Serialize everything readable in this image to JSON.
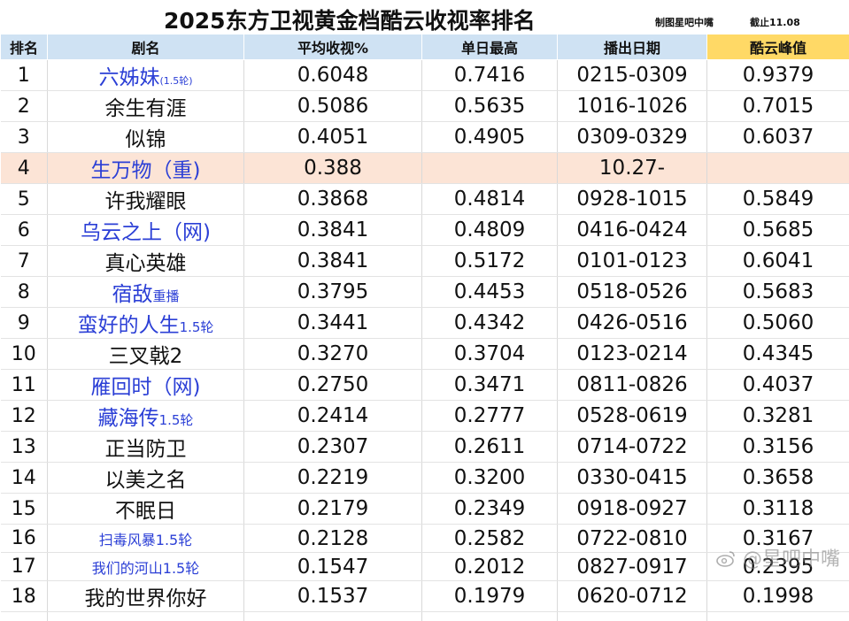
{
  "title": "2025东方卫视黄金档酷云收视率排名",
  "credit_maker": "制图星吧中嘴",
  "credit_cutoff": "截止11.08",
  "headers": [
    "排名",
    "剧名",
    "平均收视%",
    "单日最高",
    "播出日期",
    "酷云峰值"
  ],
  "rows": [
    {
      "rank": "1",
      "name": "六姊妹",
      "suffix": "(1.5轮)",
      "avg": "0.6048",
      "max": "0.7416",
      "dates": "0215-0309",
      "peak": "0.9379"
    },
    {
      "rank": "2",
      "name": "余生有涯",
      "suffix": "",
      "avg": "0.5086",
      "max": "0.5635",
      "dates": "1016-1026",
      "peak": "0.7015"
    },
    {
      "rank": "3",
      "name": "似锦",
      "suffix": "",
      "avg": "0.4051",
      "max": "0.4905",
      "dates": "0309-0329",
      "peak": "0.6037"
    },
    {
      "rank": "4",
      "name": "生万物（重)",
      "suffix": "",
      "avg": "0.388",
      "max": "",
      "dates": "10.27-",
      "peak": ""
    },
    {
      "rank": "5",
      "name": "许我耀眼",
      "suffix": "",
      "avg": "0.3868",
      "max": "0.4814",
      "dates": "0928-1015",
      "peak": "0.5849"
    },
    {
      "rank": "6",
      "name": "乌云之上（网)",
      "suffix": "",
      "avg": "0.3841",
      "max": "0.4809",
      "dates": "0416-0424",
      "peak": "0.5685"
    },
    {
      "rank": "7",
      "name": "真心英雄",
      "suffix": "",
      "avg": "0.3841",
      "max": "0.5172",
      "dates": "0101-0123",
      "peak": "0.6041"
    },
    {
      "rank": "8",
      "name": "宿敌",
      "suffix": "重播",
      "avg": "0.3795",
      "max": "0.4453",
      "dates": "0518-0526",
      "peak": "0.5683"
    },
    {
      "rank": "9",
      "name": "蛮好的人生",
      "suffix": "1.5轮",
      "avg": "0.3441",
      "max": "0.4342",
      "dates": "0426-0516",
      "peak": "0.5060"
    },
    {
      "rank": "10",
      "name": "三叉戟2",
      "suffix": "",
      "avg": "0.3270",
      "max": "0.3704",
      "dates": "0123-0214",
      "peak": "0.4345"
    },
    {
      "rank": "11",
      "name": "雁回时（网)",
      "suffix": "",
      "avg": "0.2750",
      "max": "0.3471",
      "dates": "0811-0826",
      "peak": "0.4037"
    },
    {
      "rank": "12",
      "name": "藏海传",
      "suffix": "1.5轮",
      "avg": "0.2414",
      "max": "0.2777",
      "dates": "0528-0619",
      "peak": "0.3281"
    },
    {
      "rank": "13",
      "name": "正当防卫",
      "suffix": "",
      "avg": "0.2307",
      "max": "0.2611",
      "dates": "0714-0722",
      "peak": "0.3156"
    },
    {
      "rank": "14",
      "name": "以美之名",
      "suffix": "",
      "avg": "0.2219",
      "max": "0.3200",
      "dates": "0330-0415",
      "peak": "0.3658"
    },
    {
      "rank": "15",
      "name": "不眠日",
      "suffix": "",
      "avg": "0.2179",
      "max": "0.2349",
      "dates": "0918-0927",
      "peak": "0.3118"
    },
    {
      "rank": "16",
      "name": "扫毒风暴1.5轮",
      "suffix": "",
      "avg": "0.2128",
      "max": "0.2582",
      "dates": "0722-0810",
      "peak": "0.3167"
    },
    {
      "rank": "17",
      "name": "我们的河山1.5轮",
      "suffix": "",
      "avg": "0.1547",
      "max": "0.2012",
      "dates": "0827-0917",
      "peak": "0.2395"
    },
    {
      "rank": "18",
      "name": "我的世界你好",
      "suffix": "",
      "avg": "0.1537",
      "max": "0.1979",
      "dates": "0620-0712",
      "peak": "0.1998"
    }
  ],
  "watermark": "@星吧中嘴",
  "colors": {
    "header_bg": "#cfe2f3",
    "peak_header_bg": "#ffd966",
    "highlight_row_bg": "#fce4d6",
    "blue_name": "#2b3fd6"
  }
}
